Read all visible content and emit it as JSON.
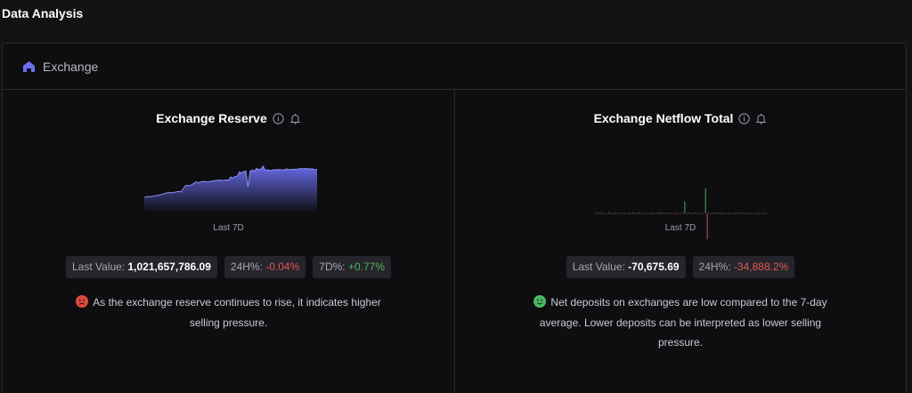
{
  "page": {
    "title": "Data Analysis"
  },
  "panel": {
    "title": "Exchange",
    "icon": "home-icon"
  },
  "colors": {
    "accent": "#6b6ff0",
    "negative": "#e25858",
    "positive": "#4db862",
    "sentiment_bad": "#e0493f",
    "sentiment_good": "#4db862"
  },
  "cards": [
    {
      "title": "Exchange Reserve",
      "period": "Last 7D",
      "stats": {
        "last_label": "Last Value: ",
        "last_value": "1,021,657,786.09",
        "h24_label": "24H%: ",
        "h24_value": "-0.04%",
        "d7_label": "7D%: ",
        "d7_value": "+0.77%"
      },
      "insight": {
        "sentiment": "negative",
        "line1": "As the exchange reserve continues to rise, it indicates higher",
        "line2": "selling pressure."
      },
      "chart_data": {
        "type": "area",
        "y": [
          10,
          10.6,
          10.8,
          10.9,
          11.1,
          11.6,
          11.9,
          12.3,
          12.8,
          13.2,
          14.1,
          14.3,
          14.4,
          14.3,
          14.7,
          15.1,
          15.4,
          14.9,
          17.6,
          20.4,
          20.8,
          20.3,
          21.4,
          22.6,
          24.0,
          22.9,
          23.6,
          24.2,
          24.1,
          23.8,
          24.0,
          24.4,
          24.6,
          25.1,
          25.3,
          25.4,
          25.0,
          25.2,
          25.5,
          25.1,
          28.2,
          27.0,
          28.6,
          28.7,
          32.6,
          31.7,
          32.9,
          33.4,
          19.4,
          33.0,
          34.2,
          33.1,
          35.6,
          34.6,
          35.0,
          37.5,
          33.9,
          34.4,
          34.0,
          33.8,
          34.7,
          34.3,
          34.6,
          34.6,
          34.1,
          34.5,
          35.2,
          34.5,
          34.8,
          34.7,
          35.0,
          34.9,
          35.3,
          35.5,
          35.2,
          35.6,
          35.1,
          35.3,
          35.1,
          34.5,
          34.5
        ],
        "grid": false,
        "legend": "none"
      }
    },
    {
      "title": "Exchange Netflow Total",
      "period": "Last 7D",
      "stats": {
        "last_label": "Last Value: ",
        "last_value": "-70,675.69",
        "h24_label": "24H%: ",
        "h24_value": "-34,888.2%"
      },
      "insight": {
        "sentiment": "positive",
        "line1": "Net deposits on exchanges are low compared to the 7-day",
        "line2": "average. Lower deposits can be interpreted as lower selling",
        "line3": "pressure."
      },
      "chart_data": {
        "type": "bar",
        "y": [
          0.6,
          -0.8,
          0.9,
          -0.5,
          1.2,
          -1.0,
          0.4,
          -0.7,
          1.1,
          -0.9,
          0.5,
          -1.3,
          0.8,
          -0.4,
          1.0,
          -0.6,
          0.7,
          -1.1,
          0.3,
          -0.8,
          1.2,
          -0.5,
          0.9,
          -0.7,
          0.6,
          -1.0,
          1.1,
          -0.4,
          0.8,
          -0.9,
          0.5,
          -0.6,
          1.0,
          -1.2,
          0.7,
          -0.5,
          0.4,
          -0.8,
          1.3,
          -0.6,
          0.9,
          -0.7,
          0.6,
          -1.0,
          0.8,
          -0.5,
          1.1,
          -0.9,
          0.5,
          -0.4,
          0.7,
          -0.8,
          14,
          -0.6,
          1.0,
          -0.7,
          0.6,
          -0.9,
          0.8,
          -1.1,
          0.5,
          -0.6,
          0.9,
          -0.5,
          29,
          -30,
          0.7,
          -0.8,
          1.0,
          -0.6,
          0.8,
          -0.9,
          0.6,
          -1.0,
          1.2,
          -0.5,
          0.7,
          -0.8,
          0.9,
          -0.6,
          0.5,
          -1.1,
          0.8,
          -0.7,
          1.0,
          -0.5,
          0.6,
          -0.9,
          0.7,
          -0.8,
          1.1,
          -0.6,
          0.5,
          -0.7,
          0.9,
          -1.0,
          0.6,
          -0.5,
          0.8,
          -0.9
        ],
        "grid": false,
        "legend": "none"
      }
    }
  ]
}
